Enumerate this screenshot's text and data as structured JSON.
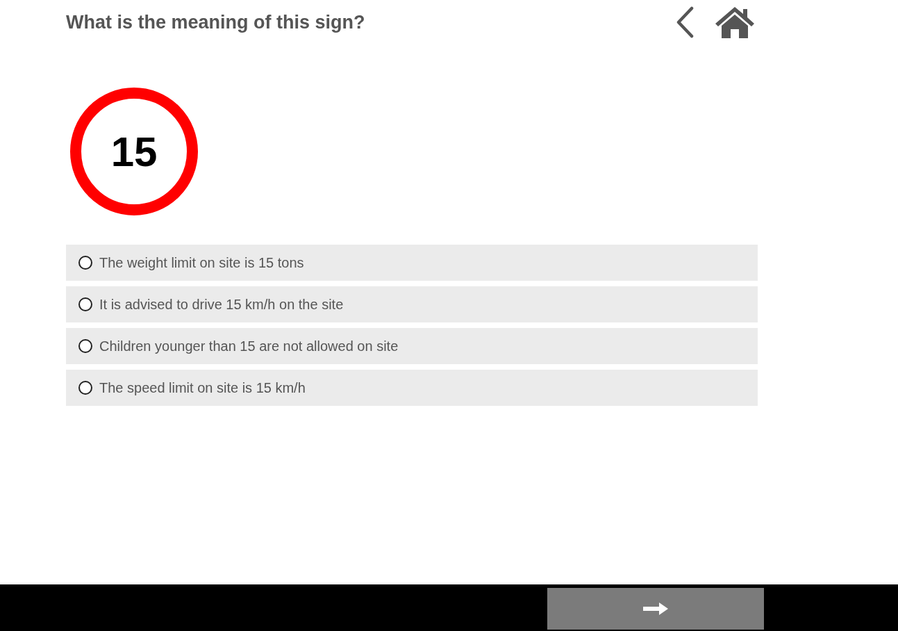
{
  "question": {
    "title": "What is the meaning of this sign?"
  },
  "sign": {
    "text": "15"
  },
  "options": [
    {
      "label": "The weight limit on site is 15 tons",
      "selected": false
    },
    {
      "label": "It is advised to drive 15 km/h on the site",
      "selected": false
    },
    {
      "label": "Children younger than 15 are not allowed on site",
      "selected": false
    },
    {
      "label": "The speed limit on site is 15 km/h",
      "selected": false
    }
  ]
}
